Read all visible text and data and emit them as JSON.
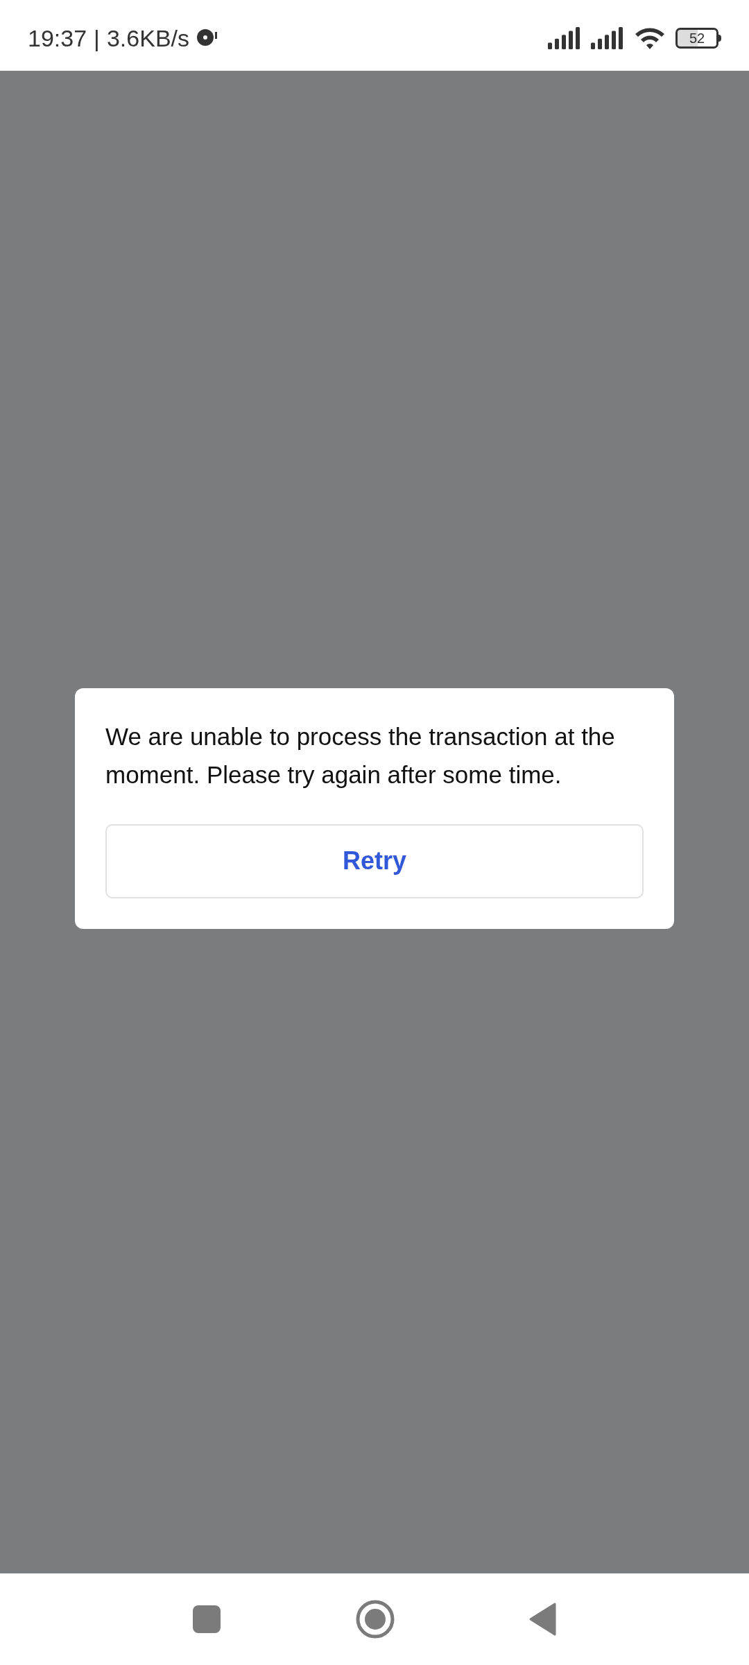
{
  "status_bar": {
    "time": "19:37",
    "separator": "|",
    "speed": "3.6KB/s",
    "battery": "52"
  },
  "dialog": {
    "message": "We are unable to process the transaction at the moment. Please try again after some time.",
    "button": "Retry"
  }
}
